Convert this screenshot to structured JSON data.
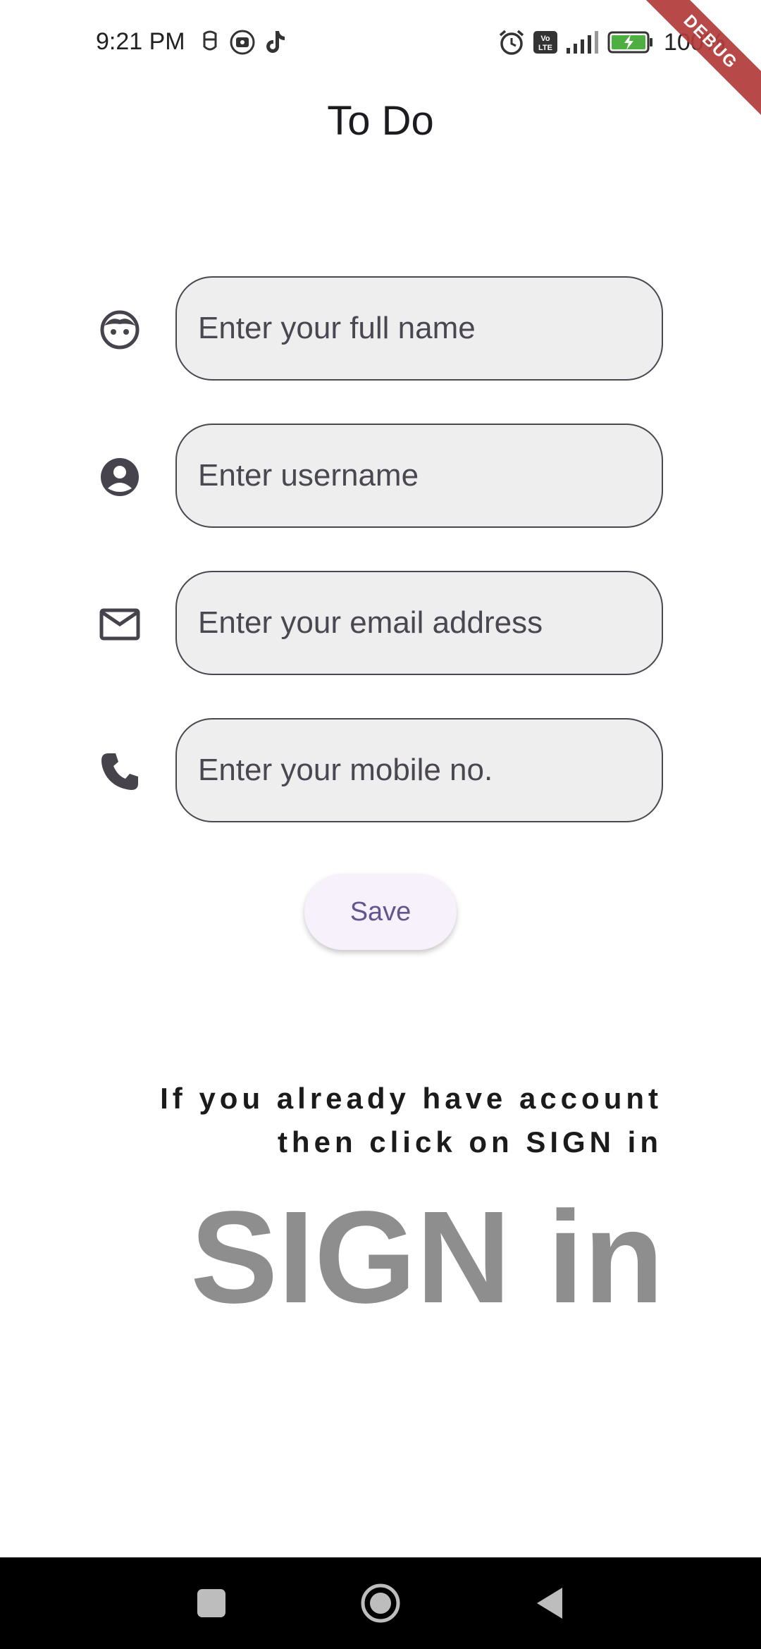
{
  "status_bar": {
    "time": "9:21 PM",
    "battery_text": "100%",
    "debug_label": "DEBUG",
    "left_icons": [
      "bug-icon",
      "screen-record-icon",
      "tiktok-icon"
    ],
    "right_icons": [
      "alarm-icon",
      "volte-icon",
      "signal-icon",
      "battery-charging-icon"
    ]
  },
  "app_bar": {
    "title": "To Do"
  },
  "form": {
    "fields": [
      {
        "icon": "face-icon",
        "placeholder": "Enter your full name",
        "value": ""
      },
      {
        "icon": "account-circle-icon",
        "placeholder": "Enter username",
        "value": ""
      },
      {
        "icon": "email-icon",
        "placeholder": "Enter your email address",
        "value": ""
      },
      {
        "icon": "phone-icon",
        "placeholder": "Enter your mobile no.",
        "value": ""
      }
    ],
    "save_label": "Save"
  },
  "signin": {
    "prompt_line1": "If you already have account",
    "prompt_line2": "then click on SIGN in",
    "link_label": "SIGN in"
  },
  "nav_bar": {
    "buttons": [
      "recents-icon",
      "home-icon",
      "back-icon"
    ]
  },
  "colors": {
    "field_fill": "#eeeeee",
    "field_border": "#4a4750",
    "button_text": "#65558f",
    "signin_link": "#8e8e8e",
    "debug_ribbon": "#b23a3a"
  }
}
